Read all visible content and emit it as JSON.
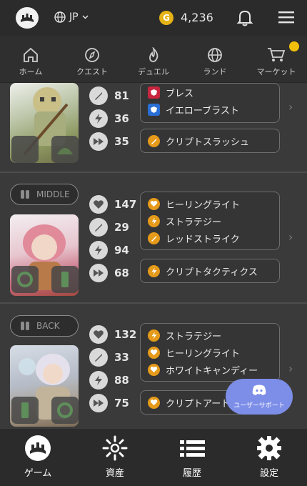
{
  "header": {
    "language": "JP",
    "coin_symbol": "G",
    "coin_balance": "4,236"
  },
  "nav": [
    {
      "label": "ホーム",
      "icon": "home-icon"
    },
    {
      "label": "クエスト",
      "icon": "compass-icon"
    },
    {
      "label": "デュエル",
      "icon": "flame-icon"
    },
    {
      "label": "ランド",
      "icon": "globe-icon"
    },
    {
      "label": "マーケット",
      "icon": "cart-icon"
    }
  ],
  "characters": [
    {
      "position": "",
      "stats": {
        "attack": "81",
        "speed": "36",
        "agility": "35"
      },
      "skills": [
        {
          "name": "ブレス",
          "icon": "red-shield-icon"
        },
        {
          "name": "イエローブラスト",
          "icon": "blue-shield-icon"
        }
      ],
      "crypt_skill": "クリプトスラッシュ"
    },
    {
      "position": "MIDDLE",
      "stats": {
        "hp": "147",
        "attack": "29",
        "speed": "94",
        "agility": "68"
      },
      "skills": [
        {
          "name": "ヒーリングライト",
          "icon": "heart-icon"
        },
        {
          "name": "ストラテジー",
          "icon": "bolt-icon"
        },
        {
          "name": "レッドストライク",
          "icon": "sword-icon"
        }
      ],
      "crypt_skill": "クリプトタクティクス"
    },
    {
      "position": "BACK",
      "stats": {
        "hp": "132",
        "attack": "33",
        "speed": "88",
        "agility": "75"
      },
      "skills": [
        {
          "name": "ストラテジー",
          "icon": "bolt-icon"
        },
        {
          "name": "ヒーリングライト",
          "icon": "heart-icon"
        },
        {
          "name": "ホワイトキャンディー",
          "icon": "heart-icon"
        }
      ],
      "crypt_skill": "クリプトアート"
    }
  ],
  "support_label": "ユーザーサポート",
  "bottom_nav": [
    {
      "label": "ゲーム",
      "icon": "paw-icon"
    },
    {
      "label": "資産",
      "icon": "sparkle-icon"
    },
    {
      "label": "履歴",
      "icon": "list-icon"
    },
    {
      "label": "設定",
      "icon": "gear-icon"
    }
  ],
  "colors": {
    "background": "#3a3a3a",
    "bar": "#2b2b2b",
    "skill_orange": "#e59a1a",
    "coin_gold": "#e5b316",
    "support_blue": "#7d8ee8"
  }
}
